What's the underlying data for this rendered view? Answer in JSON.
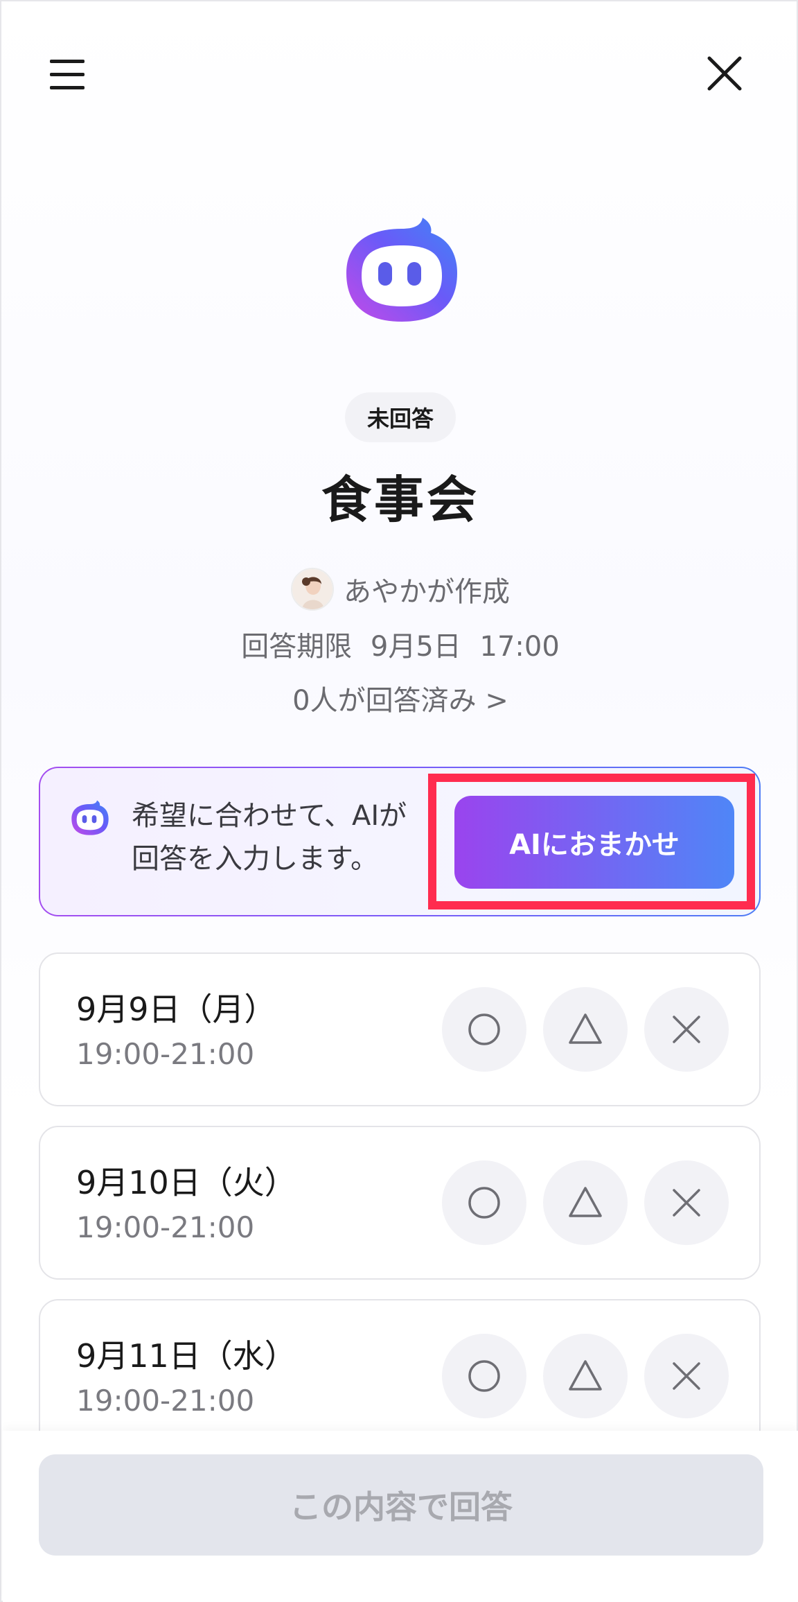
{
  "event": {
    "status": "未回答",
    "title": "食事会",
    "creator": "あやかが作成",
    "deadline": "回答期限 9月5日 17:00",
    "responded": "0人が回答済み >"
  },
  "ai": {
    "description_line1": "希望に合わせて、AIが",
    "description_line2": "回答を入力します。",
    "button_label": "AIにおまかせ",
    "gradient_start": "#9a44ee",
    "gradient_end": "#4f86f7",
    "highlight_color": "#ff2c4f"
  },
  "dates": [
    {
      "date": "9月9日（月）",
      "time": "19:00-21:00"
    },
    {
      "date": "9月10日（火）",
      "time": "19:00-21:00"
    },
    {
      "date": "9月11日（水）",
      "time": "19:00-21:00"
    }
  ],
  "options": {
    "available": "circle-icon",
    "maybe": "triangle-icon",
    "unavailable": "cross-icon"
  },
  "footer": {
    "submit_label": "この内容で回答"
  },
  "icons": {
    "menu": "hamburger-menu-icon",
    "close": "close-icon",
    "logo": "ai-mascot-icon"
  }
}
